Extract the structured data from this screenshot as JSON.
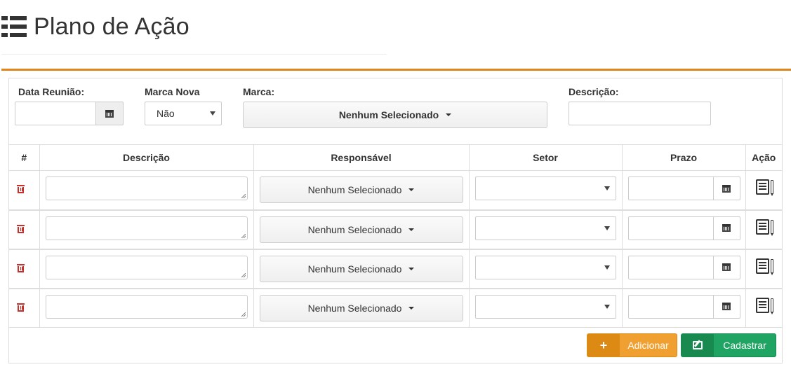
{
  "page": {
    "title": "Plano de Ação"
  },
  "filters": {
    "data_reuniao": {
      "label": "Data Reunião:",
      "value": ""
    },
    "marca_nova": {
      "label": "Marca Nova",
      "value": "Não"
    },
    "marca": {
      "label": "Marca:",
      "value": "Nenhum Selecionado"
    },
    "descricao": {
      "label": "Descrição:",
      "value": ""
    }
  },
  "table": {
    "headers": [
      "#",
      "Descrição",
      "Responsável",
      "Setor",
      "Prazo",
      "Ação"
    ],
    "rows": [
      {
        "descricao": "",
        "responsavel": "Nenhum Selecionado",
        "setor": "",
        "prazo": ""
      },
      {
        "descricao": "",
        "responsavel": "Nenhum Selecionado",
        "setor": "",
        "prazo": ""
      },
      {
        "descricao": "",
        "responsavel": "Nenhum Selecionado",
        "setor": "",
        "prazo": ""
      },
      {
        "descricao": "",
        "responsavel": "Nenhum Selecionado",
        "setor": "",
        "prazo": ""
      }
    ]
  },
  "buttons": {
    "adicionar": "Adicionar",
    "adicionar_icon": "+",
    "cadastrar": "Cadastrar"
  },
  "icons": {
    "title": "list-icon",
    "calendar": "calendar-icon",
    "delete": "trash-icon",
    "action": "edit-document-icon",
    "save": "edit-icon"
  },
  "colors": {
    "accent": "#e0851a",
    "add_button": "#f0a030",
    "save_button": "#1fa463",
    "delete": "#c9302c"
  }
}
